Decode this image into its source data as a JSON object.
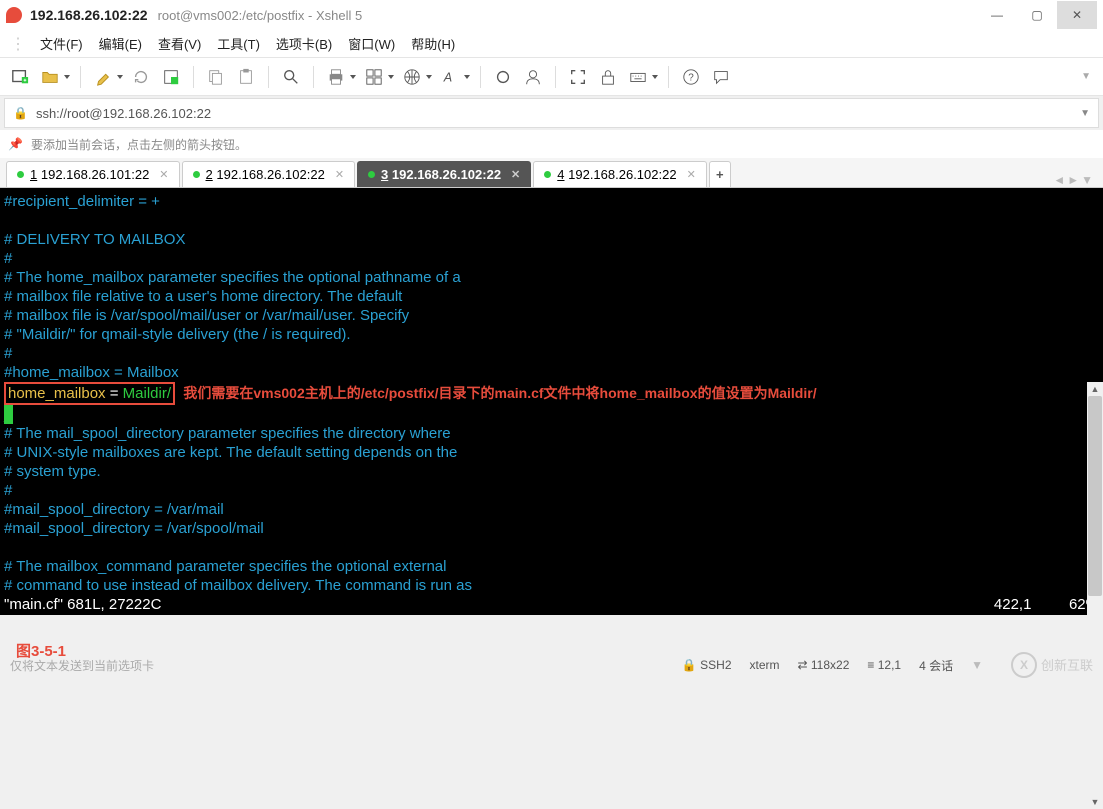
{
  "titlebar": {
    "connection": "192.168.26.102:22",
    "path": "root@vms002:/etc/postfix - Xshell 5"
  },
  "menu": {
    "file": "文件(F)",
    "edit": "编辑(E)",
    "view": "查看(V)",
    "tools": "工具(T)",
    "tabs": "选项卡(B)",
    "window": "窗口(W)",
    "help": "帮助(H)"
  },
  "addressbar": {
    "url": "ssh://root@192.168.26.102:22"
  },
  "tipbar": {
    "text": "要添加当前会话，点击左侧的箭头按钮。"
  },
  "tabs": [
    {
      "num": "1",
      "label": "192.168.26.101:22",
      "active": false
    },
    {
      "num": "2",
      "label": "192.168.26.102:22",
      "active": false
    },
    {
      "num": "3",
      "label": "192.168.26.102:22",
      "active": true
    },
    {
      "num": "4",
      "label": "192.168.26.102:22",
      "active": false
    }
  ],
  "terminal": {
    "l1": "#recipient_delimiter = +",
    "l2": "# DELIVERY TO MAILBOX",
    "l3": "#",
    "l4": "# The home_mailbox parameter specifies the optional pathname of a",
    "l5": "# mailbox file relative to a user's home directory. The default",
    "l6": "# mailbox file is /var/spool/mail/user or /var/mail/user.  Specify",
    "l7": "# \"Maildir/\" for qmail-style delivery (the / is required).",
    "l8": "#",
    "l9": "#home_mailbox = Mailbox",
    "boxed_key": "home_mailbox",
    "boxed_eq": " = ",
    "boxed_val": "Maildir/",
    "annotation": "我们需要在vms002主机上的/etc/postfix/目录下的main.cf文件中将home_mailbox的值设置为Maildir/",
    "l11": "# The mail_spool_directory parameter specifies the directory where",
    "l12": "# UNIX-style mailboxes are kept. The default setting depends on the",
    "l13": "# system type.",
    "l14": "#",
    "l15": "#mail_spool_directory = /var/mail",
    "l16": "#mail_spool_directory = /var/spool/mail",
    "l17": "# The mailbox_command parameter specifies the optional external",
    "l18": "# command to use instead of mailbox delivery. The command is run as",
    "status_file": "\"main.cf\" 681L, 27222C",
    "status_pos": "422,1",
    "status_pct": "62%"
  },
  "figure_label": "图3-5-1",
  "statusbar": {
    "msg": "仅将文本发送到当前选项卡",
    "ssh": "SSH2",
    "term": "xterm",
    "size": "118x22",
    "cursor": "12,1",
    "sessions": "4 会话",
    "logo_text1": "创新互联"
  }
}
